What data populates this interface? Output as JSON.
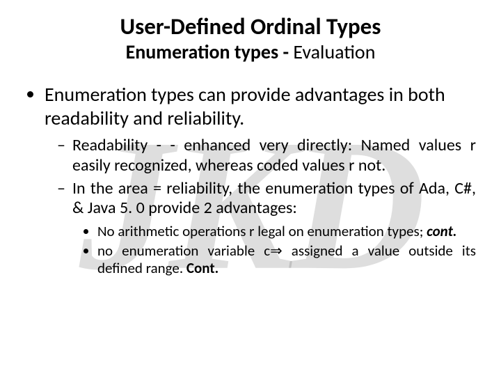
{
  "watermark": "JKD",
  "title": "User-Defined Ordinal Types",
  "subtitle": {
    "bold": "Enumeration types - ",
    "rest": "Evaluation"
  },
  "bullets": [
    {
      "text": "Enumeration types can provide advantages in both readability and reliability.",
      "sub": [
        {
          "text": "Readability - -  enhanced very directly: Named values r easily recognized, whereas coded values r not."
        },
        {
          "text": "In the area = reliability, the enumeration types of Ada, C#, & Java 5. 0 provide 2 advantages:",
          "sub": [
            {
              "text": "No arithmetic operations r legal on enumeration types; ",
              "emph": "cont."
            },
            {
              "pre": "no enumeration variable c",
              "arrow": "⇒",
              "post": " assigned a value outside its defined range. ",
              "emph": "Cont."
            }
          ]
        }
      ]
    }
  ]
}
